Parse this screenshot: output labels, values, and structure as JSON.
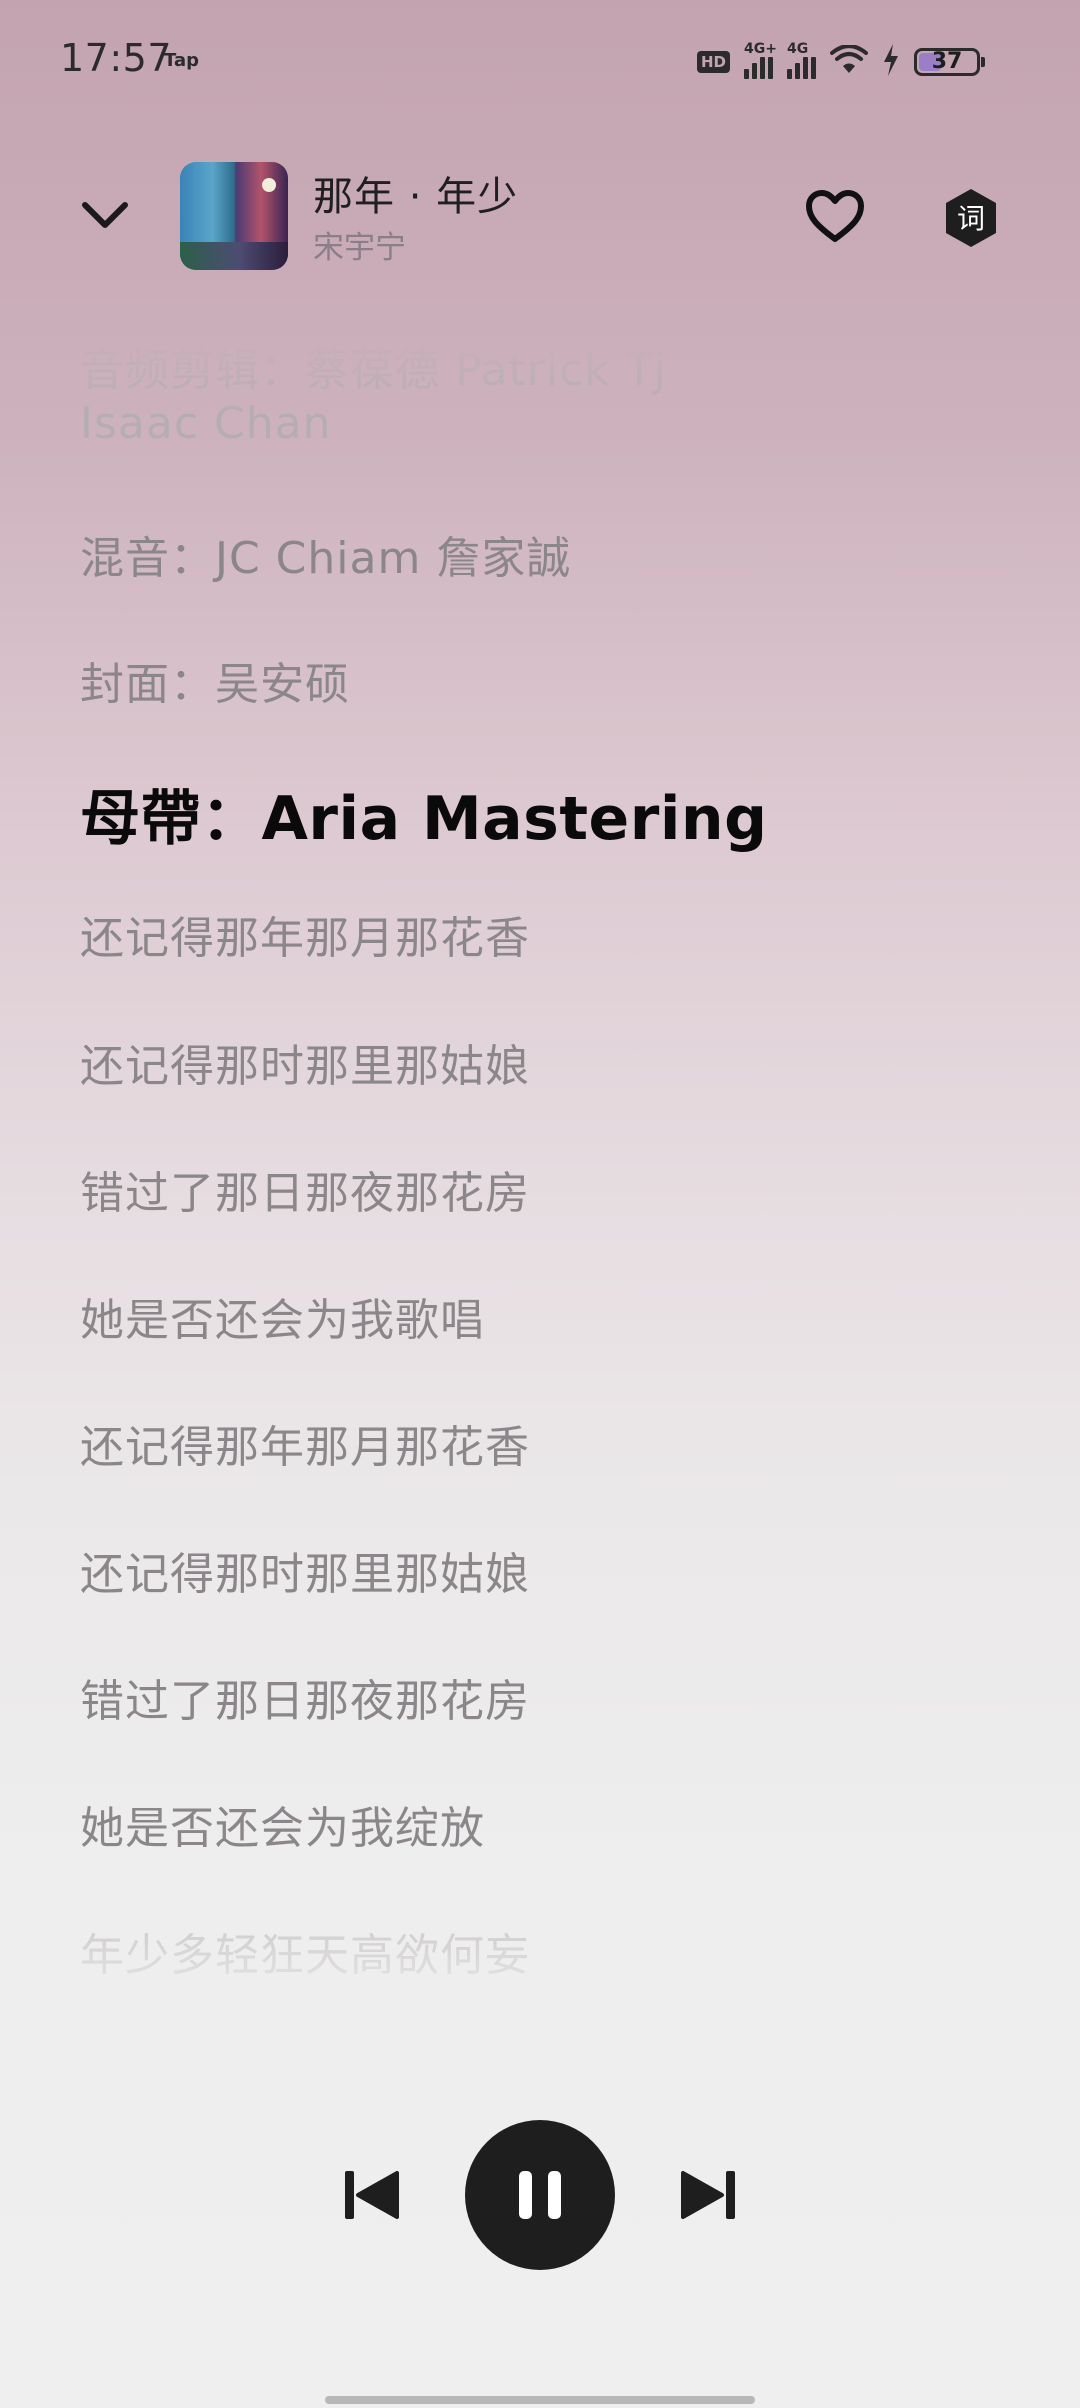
{
  "status_bar": {
    "time": "17:57",
    "tap_label": "Tap",
    "hd_label": "HD",
    "network_1": "4G+",
    "network_2": "4G",
    "battery": "37"
  },
  "header": {
    "title": "那年 · 年少",
    "artist": "宋宇宁",
    "icons": {
      "back": "chevron-down-icon",
      "favorite": "heart-icon",
      "lyrics": "lyrics-toggle-icon"
    },
    "lyric_button_label": "词"
  },
  "lyrics": {
    "lines": [
      {
        "text": "音频剪辑：蔡葆德 Patrick Tj",
        "state": "dim"
      },
      {
        "text": "Isaac Chan",
        "state": "dim"
      },
      {
        "text": "混音：JC Chiam 詹家誠",
        "state": "normal"
      },
      {
        "text": "封面：吴安硕",
        "state": "normal"
      },
      {
        "text": "母帶：Aria Mastering",
        "state": "active"
      },
      {
        "text": "还记得那年那月那花香",
        "state": "normal"
      },
      {
        "text": "还记得那时那里那姑娘",
        "state": "normal"
      },
      {
        "text": "错过了那日那夜那花房",
        "state": "normal"
      },
      {
        "text": "她是否还会为我歌唱",
        "state": "normal"
      },
      {
        "text": "还记得那年那月那花香",
        "state": "normal"
      },
      {
        "text": "还记得那时那里那姑娘",
        "state": "normal"
      },
      {
        "text": "错过了那日那夜那花房",
        "state": "normal"
      },
      {
        "text": "她是否还会为我绽放",
        "state": "normal"
      },
      {
        "text": "年少多轻狂天高欲何妄",
        "state": "faint"
      }
    ]
  },
  "player": {
    "state": "playing",
    "icons": {
      "previous": "skip-previous-icon",
      "pause": "pause-icon",
      "next": "skip-next-icon"
    }
  },
  "colors": {
    "background_top": "#c3a3b0",
    "background_bottom": "#efefef",
    "active_lyric": "#0a0a0a",
    "lyric": "#8b8689",
    "play_button": "#1e1e1e"
  }
}
